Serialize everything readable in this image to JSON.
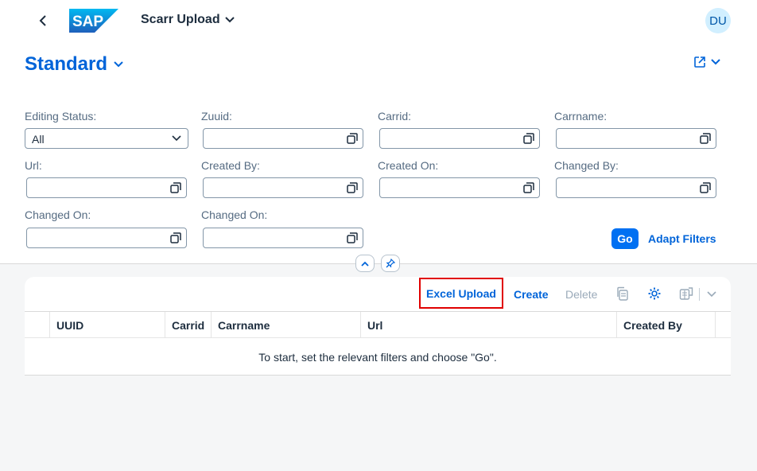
{
  "shell": {
    "app_title": "Scarr Upload",
    "logo_text": "SAP",
    "avatar_initials": "DU"
  },
  "variant": {
    "title": "Standard"
  },
  "filters": {
    "editing_status": {
      "label": "Editing Status:",
      "value": "All"
    },
    "zuuid": {
      "label": "Zuuid:",
      "value": ""
    },
    "carrid": {
      "label": "Carrid:",
      "value": ""
    },
    "carrname": {
      "label": "Carrname:",
      "value": ""
    },
    "url": {
      "label": "Url:",
      "value": ""
    },
    "created_by": {
      "label": "Created By:",
      "value": ""
    },
    "created_on": {
      "label": "Created On:",
      "value": ""
    },
    "changed_by": {
      "label": "Changed By:",
      "value": ""
    },
    "changed_on_1": {
      "label": "Changed On:",
      "value": ""
    },
    "changed_on_2": {
      "label": "Changed On:",
      "value": ""
    },
    "go_label": "Go",
    "adapt_label": "Adapt Filters"
  },
  "toolbar": {
    "excel_upload": "Excel Upload",
    "create": "Create",
    "delete": "Delete"
  },
  "table": {
    "columns": [
      "UUID",
      "Carrid",
      "Carrname",
      "Url",
      "Created By"
    ],
    "no_data": "To start, set the relevant filters and choose \"Go\"."
  },
  "colors": {
    "brand_blue": "#0070f2",
    "link_blue": "#0064d9",
    "highlight_red": "#e00000",
    "disabled_text": "#9aaab9"
  }
}
